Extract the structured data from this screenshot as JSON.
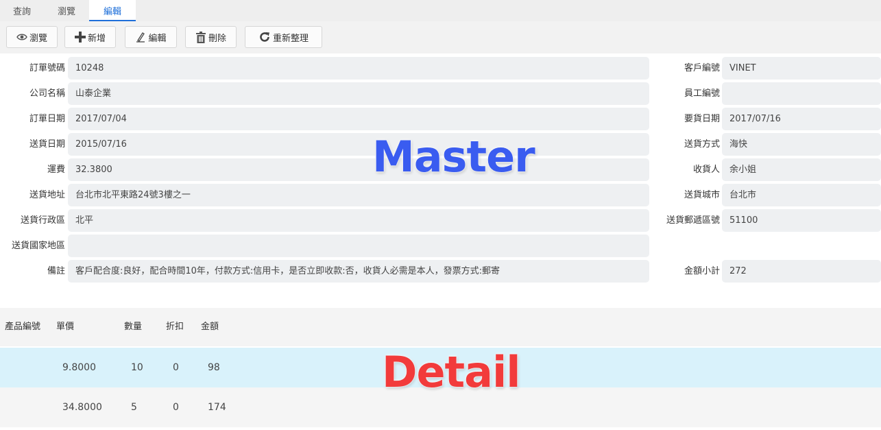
{
  "tabs": [
    {
      "label": "查詢"
    },
    {
      "label": "瀏覽"
    },
    {
      "label": "編輯"
    }
  ],
  "toolbar": {
    "view_label": "瀏覽",
    "add_label": "新增",
    "edit_label": "編輯",
    "delete_label": "刪除",
    "refresh_label": "重新整理"
  },
  "master": {
    "order_id": {
      "label": "訂單號碼",
      "value": "10248"
    },
    "customer_id": {
      "label": "客戶編號",
      "value": "VINET"
    },
    "company": {
      "label": "公司名稱",
      "value": "山泰企業"
    },
    "employee_id": {
      "label": "員工編號",
      "value": ""
    },
    "order_date": {
      "label": "訂單日期",
      "value": "2017/07/04"
    },
    "required_date": {
      "label": "要貨日期",
      "value": "2017/07/16"
    },
    "shipped_date": {
      "label": "送貨日期",
      "value": "2015/07/16"
    },
    "ship_via": {
      "label": "送貨方式",
      "value": "海快"
    },
    "freight": {
      "label": "運費",
      "value": "32.3800"
    },
    "ship_name": {
      "label": "收貨人",
      "value": "余小姐"
    },
    "ship_address": {
      "label": "送貨地址",
      "value": "台北市北平東路24號3樓之一"
    },
    "ship_city": {
      "label": "送貨城市",
      "value": "台北市"
    },
    "ship_region": {
      "label": "送貨行政區",
      "value": "北平"
    },
    "ship_postal": {
      "label": "送貨郵遞區號",
      "value": "51100"
    },
    "ship_country": {
      "label": "送貨國家地區",
      "value": ""
    },
    "remark": {
      "label": "備註",
      "value": "客戶配合度:良好，配合時間10年，付款方式:信用卡，是否立即收款:否，收貨人必需是本人，發票方式:郵寄"
    },
    "subtotal": {
      "label": "金額小計",
      "value": "272"
    }
  },
  "detail": {
    "columns": [
      "產品編號",
      "單價",
      "數量",
      "折扣",
      "金額"
    ],
    "rows": [
      {
        "product_id": "",
        "price": "9.8000",
        "qty": "10",
        "discount": "0",
        "amount": "98"
      },
      {
        "product_id": "",
        "price": "34.8000",
        "qty": "5",
        "discount": "0",
        "amount": "174"
      }
    ]
  },
  "overlays": {
    "master": "Master",
    "detail": "Detail"
  },
  "colors": {
    "accent": "#1e6fd9",
    "selected_row": "#d9f2fb",
    "master_overlay": "#3a5cf0",
    "detail_overlay": "#f23b3b"
  }
}
